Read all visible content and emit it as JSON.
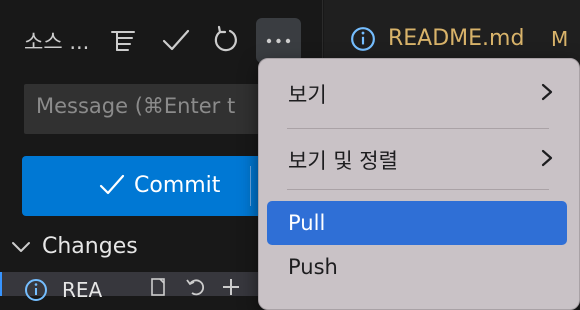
{
  "sidebar": {
    "title": "소스 ...",
    "toolbar_icons": [
      "list-tree-icon",
      "check-icon",
      "refresh-icon",
      "more-icon"
    ],
    "message_placeholder": "Message (⌘Enter t",
    "commit_label": "Commit",
    "changes_label": "Changes",
    "file_row": {
      "name": "REA",
      "icon": "info-icon"
    }
  },
  "editor": {
    "tab_label": "README.md",
    "tab_status": "M"
  },
  "menu": {
    "items": [
      {
        "label": "보기",
        "submenu": true
      },
      {
        "label": "보기 및 정렬",
        "submenu": true
      },
      {
        "label": "Pull",
        "submenu": false,
        "active": true
      },
      {
        "label": "Push",
        "submenu": false
      }
    ]
  },
  "colors": {
    "accent": "#0078d4",
    "menu_highlight": "#2f6fd6",
    "modified": "#d8b36a"
  }
}
